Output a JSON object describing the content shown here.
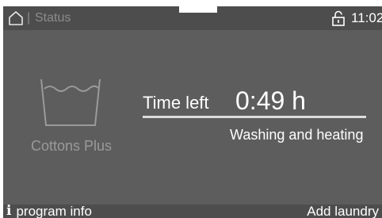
{
  "status_bar": {
    "home_icon": "home-icon",
    "separator": "|",
    "title": "Status",
    "lock_icon": "padlock-icon",
    "time": "11:02"
  },
  "program": {
    "icon": "wash-tub-icon",
    "name": "Cottons Plus"
  },
  "progress": {
    "time_left_label": "Time left",
    "time_left_value": "0:49 h",
    "fraction_complete": 1.0,
    "phase": "Washing and heating"
  },
  "bottom_bar": {
    "info_icon": "info-icon",
    "info_label": "program info",
    "add_laundry_label": "Add laundry"
  },
  "colors": {
    "screen_background": "#5d5d5d",
    "bar_background": "#4d4d4d",
    "text_primary": "#ffffff",
    "text_dim": "#9a9a9a"
  }
}
